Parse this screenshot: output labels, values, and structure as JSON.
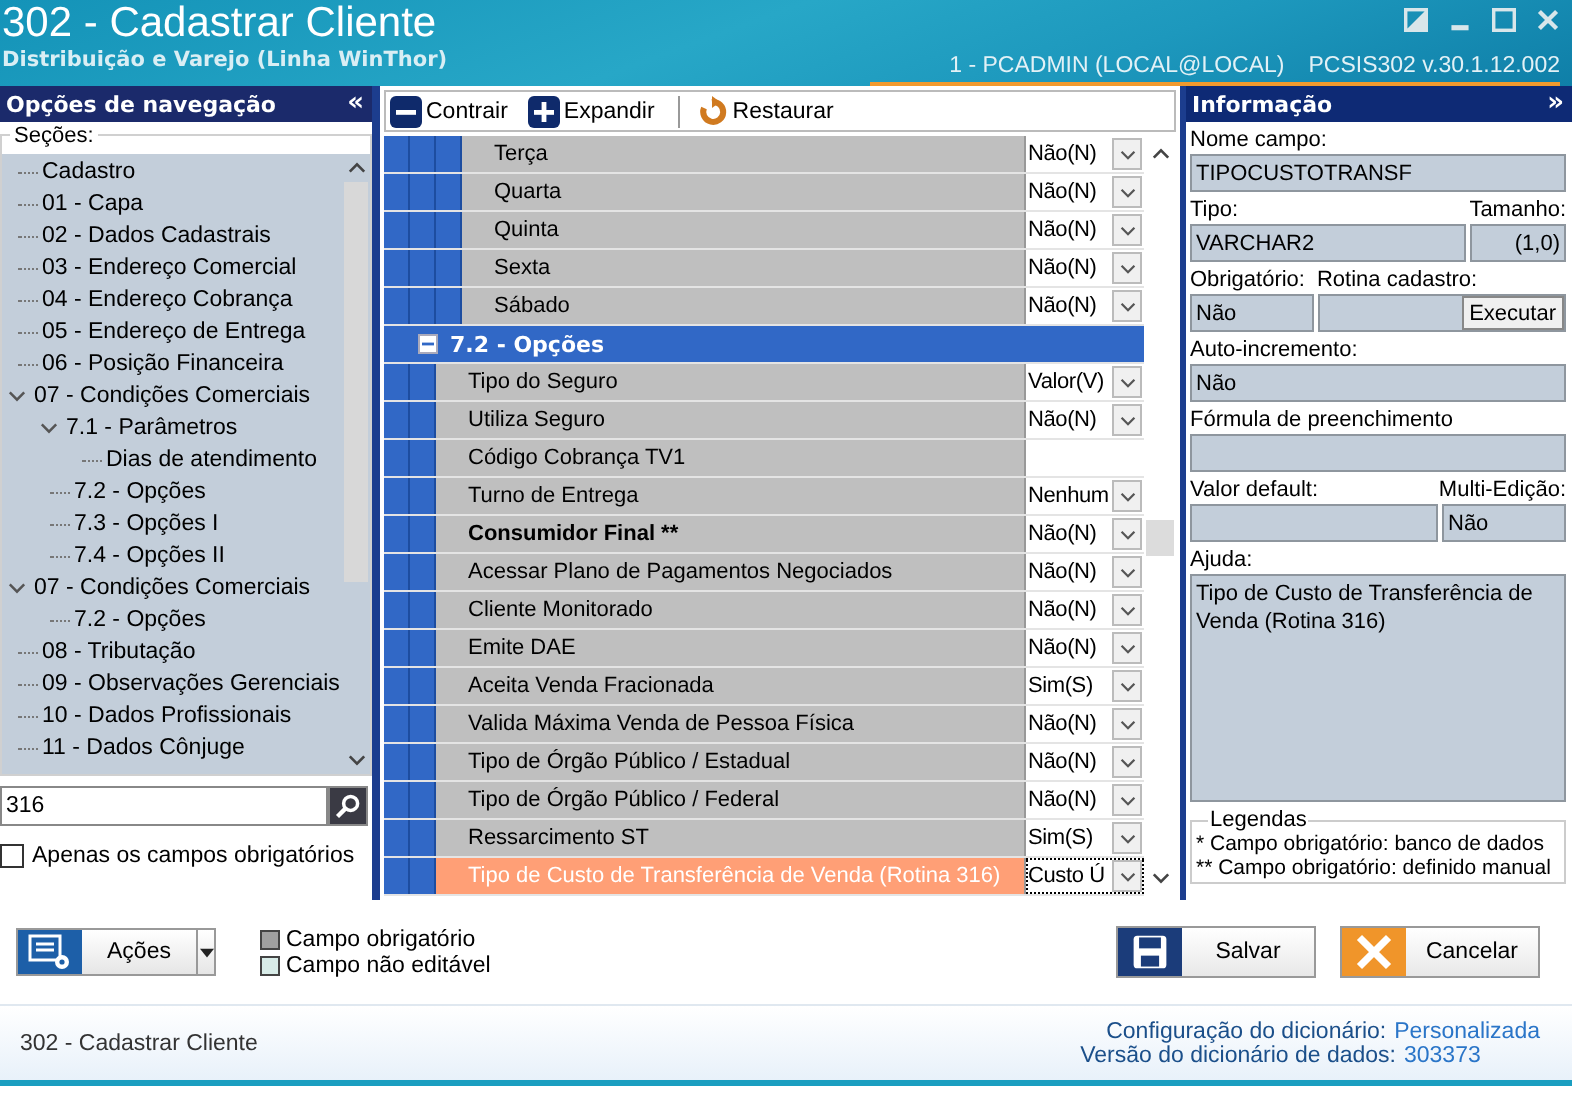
{
  "window": {
    "title": "302 - Cadastrar Cliente",
    "subtitle": "Distribuição e Varejo (Linha WinThor)",
    "user": "1 - PCADMIN (LOCAL@LOCAL)",
    "version": "PCSIS302  v.30.1.12.002"
  },
  "navigation": {
    "title": "Opções de navegação",
    "collapse": "«",
    "sections_label": "Seções:",
    "items": [
      {
        "label": "Cadastro"
      },
      {
        "label": "01 - Capa"
      },
      {
        "label": "02 - Dados Cadastrais"
      },
      {
        "label": "03 - Endereço Comercial"
      },
      {
        "label": "04 - Endereço Cobrança"
      },
      {
        "label": "05 - Endereço de Entrega"
      },
      {
        "label": "06 - Posição Financeira"
      },
      {
        "label": "07 - Condições Comerciais",
        "expanded": true,
        "children": [
          {
            "label": "7.1 - Parâmetros",
            "expanded": true,
            "children": [
              {
                "label": "Dias de atendimento"
              }
            ]
          },
          {
            "label": "7.2 - Opções"
          },
          {
            "label": "7.3 - Opções I"
          },
          {
            "label": "7.4 - Opções II"
          }
        ]
      },
      {
        "label": "07 - Condições Comerciais",
        "expanded": true,
        "children": [
          {
            "label": "7.2 - Opções"
          }
        ]
      },
      {
        "label": "08 - Tributação"
      },
      {
        "label": "09 - Observações Gerenciais"
      },
      {
        "label": "10 - Dados Profissionais"
      },
      {
        "label": "11 - Dados Cônjuge"
      }
    ],
    "search_value": "316",
    "only_required": {
      "label": "Apenas os campos obrigatórios",
      "checked": false
    }
  },
  "toolbar": [
    {
      "label": "Contrair"
    },
    {
      "label": "Expandir"
    },
    {
      "label": "Restaurar"
    }
  ],
  "grid": {
    "groups": [
      {
        "kind": "subgroup",
        "rows": [
          {
            "label": "Terça",
            "value": "Não(N)",
            "kind": "dropdown",
            "bold": false,
            "selected": false
          },
          {
            "label": "Quarta",
            "value": "Não(N)",
            "kind": "dropdown",
            "bold": false,
            "selected": false
          },
          {
            "label": "Quinta",
            "value": "Não(N)",
            "kind": "dropdown",
            "bold": false,
            "selected": false
          },
          {
            "label": "Sexta",
            "value": "Não(N)",
            "kind": "dropdown",
            "bold": false,
            "selected": false
          },
          {
            "label": "Sábado",
            "value": "Não(N)",
            "kind": "dropdown",
            "bold": false,
            "selected": false
          }
        ]
      },
      {
        "kind": "group",
        "title": "7.2 - Opções",
        "expanded": true,
        "rows": [
          {
            "label": "Tipo do Seguro",
            "value": "Valor(V)",
            "kind": "dropdown",
            "bold": false,
            "selected": false
          },
          {
            "label": "Utiliza Seguro",
            "value": "Não(N)",
            "kind": "dropdown",
            "bold": false,
            "selected": false
          },
          {
            "label": "Código Cobrança TV1",
            "kind": "text",
            "bold": false,
            "selected": false
          },
          {
            "label": "Turno de Entrega",
            "value": "Nenhum",
            "kind": "dropdown",
            "bold": false,
            "selected": false
          },
          {
            "label": "Consumidor Final **",
            "value": "Não(N)",
            "kind": "dropdown",
            "bold": true,
            "selected": false
          },
          {
            "label": "Acessar Plano de Pagamentos Negociados",
            "value": "Não(N)",
            "kind": "dropdown",
            "bold": false,
            "selected": false
          },
          {
            "label": "Cliente Monitorado",
            "value": "Não(N)",
            "kind": "dropdown",
            "bold": false,
            "selected": false
          },
          {
            "label": "Emite DAE",
            "value": "Não(N)",
            "kind": "dropdown",
            "bold": false,
            "selected": false
          },
          {
            "label": "Aceita Venda Fracionada",
            "value": "Sim(S)",
            "kind": "dropdown",
            "bold": false,
            "selected": false
          },
          {
            "label": "Valida Máxima Venda de Pessoa Física",
            "value": "Não(N)",
            "kind": "dropdown",
            "bold": false,
            "selected": false
          },
          {
            "label": "Tipo de Órgão Público / Estadual",
            "value": "Não(N)",
            "kind": "dropdown",
            "bold": false,
            "selected": false
          },
          {
            "label": "Tipo de Órgão Público / Federal",
            "value": "Não(N)",
            "kind": "dropdown",
            "bold": false,
            "selected": false
          },
          {
            "label": "Ressarcimento ST",
            "value": "Sim(S)",
            "kind": "dropdown",
            "bold": false,
            "selected": false
          },
          {
            "label": "Tipo de Custo de Transferência de Venda (Rotina 316)",
            "value": "Custo Ú",
            "kind": "dropdown",
            "bold": false,
            "selected": true
          }
        ]
      }
    ]
  },
  "info": {
    "title": "Informação",
    "expand": "»",
    "field_name_label": "Nome campo:",
    "field_name": "TIPOCUSTOTRANSF",
    "type_label": "Tipo:",
    "size_label": "Tamanho:",
    "type": "VARCHAR2",
    "size": "(1,0)",
    "required_label": "Obrigatório:",
    "routine_label": "Rotina cadastro:",
    "required": "Não",
    "execute": "Executar",
    "autoinc_label": "Auto-incremento:",
    "autoinc": "Não",
    "formula_label": "Fórmula de preenchimento",
    "default_label": "Valor default:",
    "multi_label": "Multi-Edição:",
    "multi": "Não",
    "help_label": "Ajuda:",
    "help": "Tipo de Custo de Transferência de Venda (Rotina 316)",
    "legend_title": "Legendas",
    "legend": [
      "* Campo obrigatório: banco de dados",
      "** Campo obrigatório: definido manual"
    ]
  },
  "footer": {
    "actions": "Ações",
    "legend": [
      {
        "label": "Campo obrigatório",
        "color": "#a0a0a0"
      },
      {
        "label": "Campo não editável",
        "color": "#d8ece8"
      }
    ],
    "save": "Salvar",
    "cancel": "Cancelar"
  },
  "status_bar": {
    "screen": "302 - Cadastrar Cliente",
    "dict_config_label": "Configuração do dicionário:",
    "dict_config": "Personalizada",
    "dict_version_label": "Versão do dicionário de dados:",
    "dict_version": "303373"
  }
}
